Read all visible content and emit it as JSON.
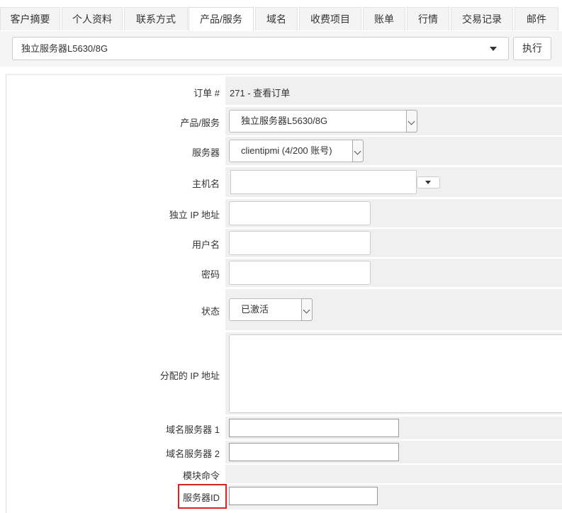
{
  "tabs": [
    {
      "label": "客户摘要",
      "active": false
    },
    {
      "label": "个人资料",
      "active": false
    },
    {
      "label": "联系方式",
      "active": false
    },
    {
      "label": "产品/服务",
      "active": true
    },
    {
      "label": "域名",
      "active": false
    },
    {
      "label": "收费项目",
      "active": false
    },
    {
      "label": "账单",
      "active": false
    },
    {
      "label": "行情",
      "active": false
    },
    {
      "label": "交易记录",
      "active": false
    },
    {
      "label": "邮件",
      "active": false
    }
  ],
  "service_selector": {
    "value": "独立服务器L5630/8G",
    "execute_label": "执行"
  },
  "form": {
    "order": {
      "label": "订单 #",
      "value": "271 - 查看订单"
    },
    "product": {
      "label": "产品/服务",
      "value": "独立服务器L5630/8G"
    },
    "server": {
      "label": "服务器",
      "value": "clientipmi (4/200 账号)"
    },
    "hostname": {
      "label": "主机名",
      "value": ""
    },
    "dedicated_ip": {
      "label": "独立 IP 地址",
      "value": ""
    },
    "username": {
      "label": "用户名",
      "value": ""
    },
    "password": {
      "label": "密码",
      "value": ""
    },
    "status": {
      "label": "状态",
      "value": "已激活"
    },
    "assigned_ips": {
      "label": "分配的 IP 地址",
      "value": ""
    },
    "ns1": {
      "label": "域名服务器 1",
      "value": ""
    },
    "ns2": {
      "label": "域名服务器 2",
      "value": ""
    },
    "module_commands": {
      "label": "模块命令"
    },
    "server_id": {
      "label": "服务器ID",
      "value": ""
    }
  },
  "colors": {
    "highlight": "#d9231c",
    "field_bg": "#f0f0f0",
    "tab_bg": "#f4f4f4"
  }
}
